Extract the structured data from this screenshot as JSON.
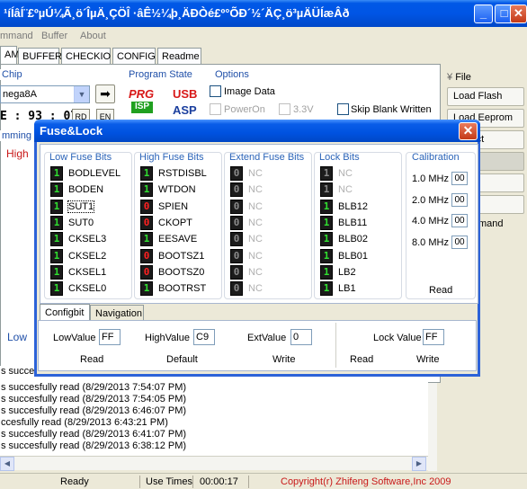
{
  "window": {
    "title": "¹íÍâÍ¨£ºµÚ¼Ã¸ö´ÎµÄ¸ÇÖÎ ·âÊ½¼þ¸ÄÐ­Òé£º°ÕÐ´½´ÄÇ¸ö³µÄÜÍæÂð"
  },
  "menu": [
    "mmand",
    "Buffer",
    "About"
  ],
  "main_tabs": [
    "AM",
    "BUFFER",
    "CHECKIO",
    "CONFIG",
    "Readme"
  ],
  "chip": {
    "group_label": "Chip",
    "selected": "nega8A",
    "e_label": "E : 93 : 07",
    "btn_rd": "RD",
    "btn_en": "EN"
  },
  "program_state": {
    "label": "Program State",
    "prg": "PRG",
    "isp": "ISP",
    "usb": "USB",
    "asp": "ASP"
  },
  "options": {
    "label": "Options",
    "image_data": "Image Data",
    "power_on": "PowerOn",
    "v33": "3.3V",
    "skip_blank": "Skip Blank Written"
  },
  "left_side": {
    "mming": "mming",
    "high": "High",
    "low": "Low"
  },
  "right_panel": {
    "file_label": "File",
    "items": [
      "Load Flash",
      "Load Eeprom",
      "Project",
      "Flash",
      "prom",
      "roject",
      "mand"
    ]
  },
  "dialog": {
    "title": "Fuse&Lock",
    "columns": {
      "low_title": "Low Fuse Bits",
      "high_title": "High Fuse Bits",
      "ext_title": "Extend Fuse Bits",
      "lock_title": "Lock Bits",
      "cal_title": "Calibration"
    },
    "low": [
      {
        "v": "1",
        "name": "BODLEVEL"
      },
      {
        "v": "1",
        "name": "BODEN"
      },
      {
        "v": "1",
        "name": "SUT1"
      },
      {
        "v": "1",
        "name": "SUT0"
      },
      {
        "v": "1",
        "name": "CKSEL3"
      },
      {
        "v": "1",
        "name": "CKSEL2"
      },
      {
        "v": "1",
        "name": "CKSEL1"
      },
      {
        "v": "1",
        "name": "CKSEL0"
      }
    ],
    "high": [
      {
        "v": "1",
        "name": "RSTDISBL"
      },
      {
        "v": "1",
        "name": "WTDON"
      },
      {
        "v": "0",
        "name": "SPIEN"
      },
      {
        "v": "0",
        "name": "CKOPT"
      },
      {
        "v": "1",
        "name": "EESAVE"
      },
      {
        "v": "0",
        "name": "BOOTSZ1"
      },
      {
        "v": "0",
        "name": "BOOTSZ0"
      },
      {
        "v": "1",
        "name": "BOOTRST"
      }
    ],
    "ext": [
      {
        "v": "0",
        "name": "NC"
      },
      {
        "v": "0",
        "name": "NC"
      },
      {
        "v": "0",
        "name": "NC"
      },
      {
        "v": "0",
        "name": "NC"
      },
      {
        "v": "0",
        "name": "NC"
      },
      {
        "v": "0",
        "name": "NC"
      },
      {
        "v": "0",
        "name": "NC"
      },
      {
        "v": "0",
        "name": "NC"
      }
    ],
    "lock": [
      {
        "v": "1",
        "name": "NC"
      },
      {
        "v": "1",
        "name": "NC"
      },
      {
        "v": "1",
        "name": "BLB12"
      },
      {
        "v": "1",
        "name": "BLB11"
      },
      {
        "v": "1",
        "name": "BLB02"
      },
      {
        "v": "1",
        "name": "BLB01"
      },
      {
        "v": "1",
        "name": "LB2"
      },
      {
        "v": "1",
        "name": "LB1"
      }
    ],
    "calibration": [
      {
        "label": "1.0 MHz",
        "value": "00"
      },
      {
        "label": "2.0 MHz",
        "value": "00"
      },
      {
        "label": "4.0 MHz",
        "value": "00"
      },
      {
        "label": "8.0 MHz",
        "value": "00"
      }
    ],
    "cal_read": "Read",
    "subtabs": [
      "Configbit",
      "Navigation"
    ],
    "low_value_label": "LowValue",
    "low_value": "FF",
    "high_value_label": "HighValue",
    "high_value": "C9",
    "ext_value_label": "ExtValue",
    "ext_value": "0",
    "lock_value_label": "Lock Value",
    "lock_value": "FF",
    "btn_read": "Read",
    "btn_default": "Default",
    "btn_write": "Write",
    "btn_read2": "Read",
    "btn_write2": "Write"
  },
  "log": [
    "s succesfu",
    "s succesfully read (8/29/2013 7:54:07 PM)",
    "s succesfully read (8/29/2013 7:54:05 PM)",
    "s succesfully read (8/29/2013 6:46:07 PM)",
    "ccesfully read (8/29/2013 6:43:21 PM)",
    "s succesfully read (8/29/2013 6:41:07 PM)",
    "s succesfully read (8/29/2013 6:38:12 PM)"
  ],
  "status": {
    "ready": "Ready",
    "use_times": "Use Times",
    "time": "00:00:17",
    "copyright": "Copyright(r) Zhifeng Software,Inc 2009"
  }
}
